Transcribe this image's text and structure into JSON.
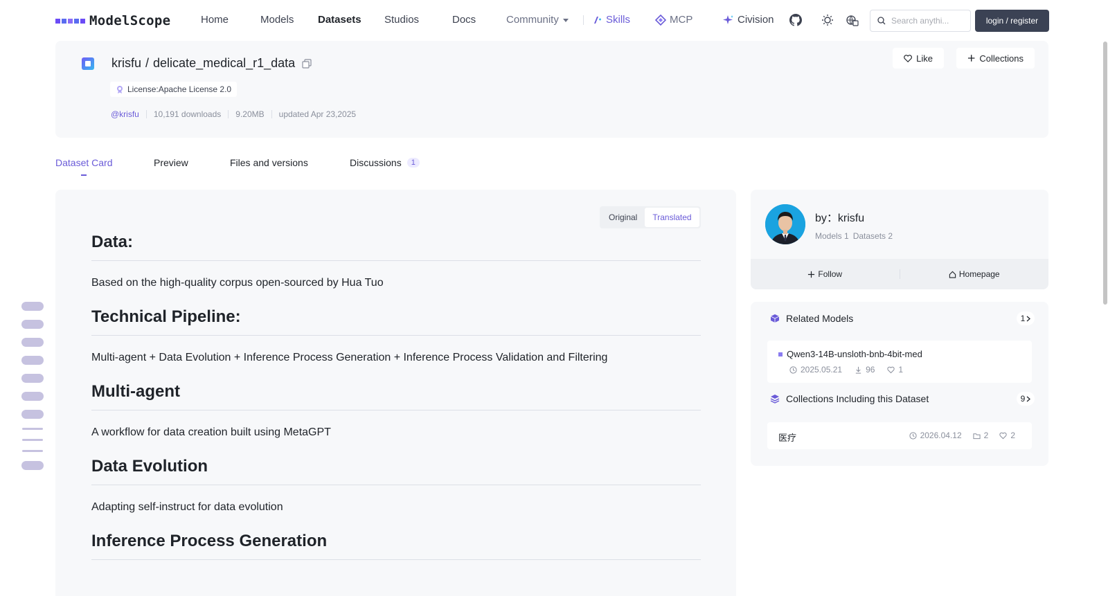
{
  "nav": {
    "logo_text": "ModelScope",
    "links": [
      "Home",
      "Models",
      "Datasets",
      "Studios",
      "Docs"
    ],
    "community": "Community",
    "skills": "Skills",
    "mcp": "MCP",
    "civision": "Civision",
    "search_placeholder": "Search anythi...",
    "login": "login / register",
    "accent": "#6a5bd8"
  },
  "repo": {
    "owner": "krisfu",
    "separator": "/",
    "name": "delicate_medical_r1_data",
    "license": "License:Apache License 2.0",
    "author_tag": "@krisfu",
    "downloads": "10,191 downloads",
    "size": "9.20MB",
    "updated": "updated Apr 23,2025",
    "like": "Like",
    "collections": "Collections"
  },
  "tabs": [
    {
      "label": "Dataset Card"
    },
    {
      "label": "Preview"
    },
    {
      "label": "Files and versions"
    },
    {
      "label": "Discussions",
      "badge": "1"
    }
  ],
  "card": {
    "toggle_original": "Original",
    "toggle_translated": "Translated",
    "sections": [
      {
        "heading": "Data:",
        "text": "Based on the high-quality corpus open-sourced by Hua Tuo"
      },
      {
        "heading": "Technical Pipeline:",
        "text": "Multi-agent + Data Evolution + Inference Process Generation + Inference Process Validation and Filtering"
      },
      {
        "heading": "Multi-agent",
        "text": "A workflow for data creation built using MetaGPT"
      },
      {
        "heading": "Data Evolution",
        "text": "Adapting self-instruct for data evolution"
      },
      {
        "heading": "Inference Process Generation",
        "text": ""
      }
    ]
  },
  "author": {
    "by": "by：krisfu",
    "models": "Models 1",
    "datasets": "Datasets 2",
    "follow": "Follow",
    "homepage": "Homepage"
  },
  "related_models": {
    "title": "Related Models",
    "count": "1",
    "items": [
      {
        "name": "Qwen3-14B-unsloth-bnb-4bit-med",
        "date": "2025.05.21",
        "downloads": "96",
        "likes": "1"
      }
    ]
  },
  "collections": {
    "title": "Collections Including this Dataset",
    "count": "9",
    "items": [
      {
        "name": "医疗",
        "date": "2026.04.12",
        "items": "2",
        "likes": "2"
      }
    ]
  }
}
